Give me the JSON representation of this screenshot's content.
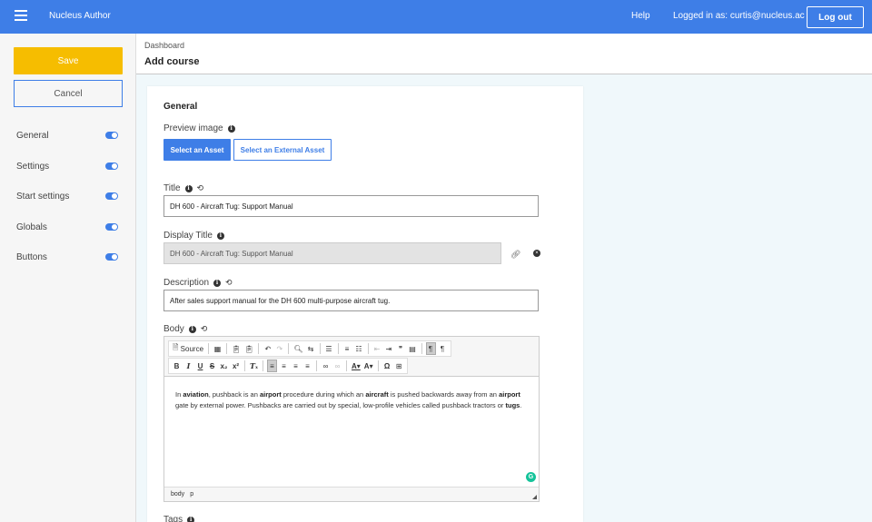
{
  "topbar": {
    "app_title": "Nucleus Author",
    "help": "Help",
    "logged_in": "Logged in as: curtis@nucleus.ac",
    "logout": "Log out"
  },
  "sidebar": {
    "save": "Save",
    "cancel": "Cancel",
    "items": [
      {
        "label": "General",
        "enabled": true
      },
      {
        "label": "Settings",
        "enabled": true
      },
      {
        "label": "Start settings",
        "enabled": true
      },
      {
        "label": "Globals",
        "enabled": true
      },
      {
        "label": "Buttons",
        "enabled": true
      }
    ]
  },
  "header": {
    "breadcrumb": "Dashboard",
    "title": "Add course"
  },
  "form": {
    "section": "General",
    "preview_label": "Preview image",
    "select_asset": "Select an Asset",
    "select_external": "Select an External Asset",
    "title_label": "Title",
    "title_value": "DH 600 - Aircraft Tug: Support Manual",
    "display_title_label": "Display Title",
    "display_title_value": "DH 600 - Aircraft Tug: Support Manual",
    "description_label": "Description",
    "description_value": "After sales support manual for the DH 600 multi-purpose aircraft tug.",
    "body_label": "Body",
    "tags_label": "Tags"
  },
  "editor": {
    "source_label": "Source",
    "body": {
      "p1": "In ",
      "b1": "aviation",
      "p2": ", pushback is an ",
      "b2": "airport",
      "p3": " procedure during which an ",
      "b3": "aircraft",
      "p4": " is pushed backwards away from an ",
      "b4": "airport",
      "p5": " gate by external power. Pushbacks are carried out by special, low-profile vehicles called pushback tractors or ",
      "b5": "tugs",
      "p6": "."
    },
    "path_body": "body",
    "path_p": "p"
  },
  "colors": {
    "accent": "#3e7ee7",
    "save": "#f6bd00"
  }
}
